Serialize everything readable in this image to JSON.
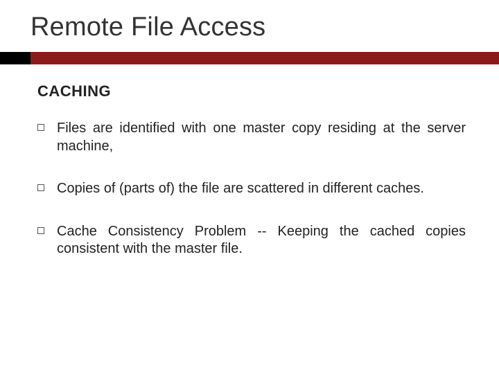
{
  "title": "Remote File Access",
  "subhead": "CACHING",
  "bullets": [
    "Files are identified with one master copy residing at the server machine,",
    "Copies of (parts of) the file are scattered in different caches.",
    "Cache Consistency Problem -- Keeping the cached copies consistent with the master file."
  ]
}
